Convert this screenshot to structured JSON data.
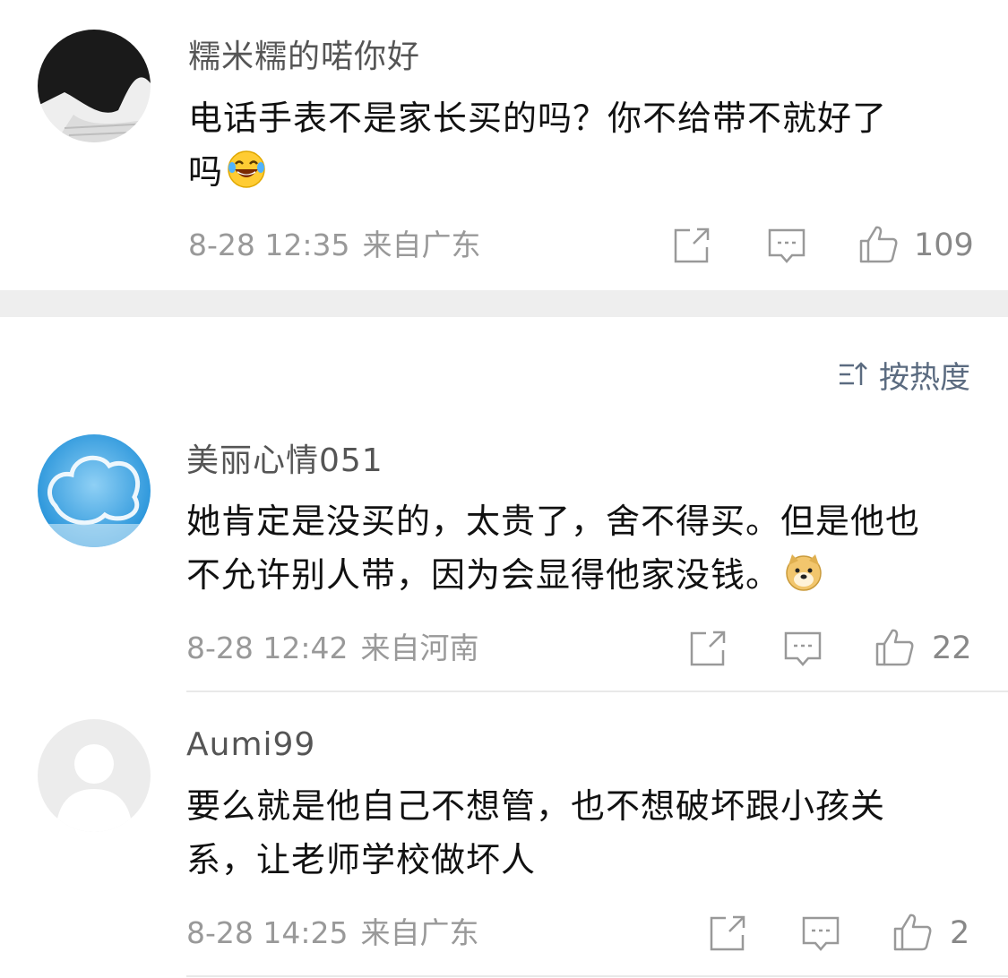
{
  "comments": [
    {
      "username": "糯米糯的喏你好",
      "text_lines": [
        "电话手表不是家长买的吗？你不给带不就好了",
        "吗"
      ],
      "emoji": "laugh-crying-emoji",
      "time": "8-28 12:35",
      "source": "来自广东",
      "likes": "109"
    },
    {
      "username": "美丽心情051",
      "text_lines": [
        "她肯定是没买的，太贵了，舍不得买。但是他也",
        "不允许别人带，因为会显得他家没钱。"
      ],
      "emoji": "doge-emoji",
      "time": "8-28 12:42",
      "source": "来自河南",
      "likes": "22"
    },
    {
      "username": "Aumi99",
      "text_lines": [
        "要么就是他自己不想管，也不想破坏跟小孩关",
        "系，让老师学校做坏人"
      ],
      "emoji": "",
      "time": "8-28 14:25",
      "source": "来自广东",
      "likes": "2"
    }
  ],
  "sort": {
    "label": "按热度",
    "icon": "sort-icon"
  },
  "colors": {
    "meta": "#999999",
    "sort": "#5b6b80",
    "divider": "#eeeeee"
  }
}
